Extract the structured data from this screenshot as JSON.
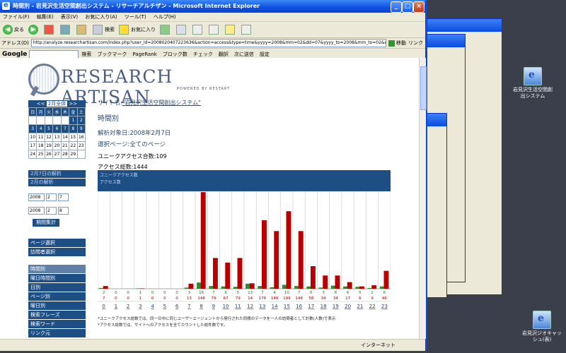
{
  "window": {
    "title": "時間別 - 岩見沢生活空間創出システム - リサーチアルチザン - Microsoft Internet Explorer"
  },
  "menu": [
    "ファイル(F)",
    "編集(E)",
    "表示(V)",
    "お気に入り(A)",
    "ツール(T)",
    "ヘルプ(H)"
  ],
  "toolbar": {
    "back": "戻る",
    "search": "検索",
    "favorites": "お気に入り"
  },
  "address": {
    "label": "アドレス(D)",
    "value": "http://analyze.researchartisan.com/index.php?user_id=2008020407223636&action=access&type=time&yyyy=2008&mm=02&dd=07&yyyy_to=2008&mm_to=02&dd",
    "go": "移動",
    "links": "リンク"
  },
  "google": {
    "logo": "Google",
    "items": [
      "検索",
      "ブックマーク",
      "PageRank",
      "ブロック数",
      "チェック",
      "翻訳",
      "次に送信"
    ],
    "settings": "設定"
  },
  "logo": {
    "name": "RESEARCH ARTISAN",
    "sub": "POWERED BY RESTART"
  },
  "calendar": {
    "prev": "<<",
    "month": "2月全体",
    "next": ">>",
    "days": [
      "日",
      "月",
      "火",
      "水",
      "木",
      "金",
      "土"
    ],
    "rows": [
      [
        "",
        "",
        "",
        "",
        "",
        "1",
        "2"
      ],
      [
        "3",
        "4",
        "5",
        "6",
        "7",
        "8",
        "9"
      ],
      [
        "10",
        "11",
        "12",
        "13",
        "14",
        "15",
        "16"
      ],
      [
        "17",
        "18",
        "19",
        "20",
        "21",
        "22",
        "23"
      ],
      [
        "24",
        "25",
        "26",
        "27",
        "28",
        "29",
        ""
      ]
    ]
  },
  "sidebar": {
    "analysis_day": "2月7日の解析",
    "analysis_month": "2月の解析",
    "from": {
      "year": "2008",
      "month": "2",
      "day": "7"
    },
    "to": {
      "year": "2008",
      "month": "2",
      "day": "8"
    },
    "calc_button": "期間集計",
    "page_select": "ページ選択",
    "visitor_select": "訪問者選択",
    "reports": [
      "時間別",
      "曜日時間別",
      "日別",
      "ページ別",
      "曜日別",
      "検索フレーズ",
      "検索ワード",
      "リンク元"
    ]
  },
  "main": {
    "site_prefix": "サイト名:",
    "site_name": "\"岩見沢生活空間創出システム\"",
    "heading": "時間別",
    "date": "解析対象日:2008年2月7日",
    "page": "選択ページ:全てのページ",
    "unique": "ユニークアクセス合数:109",
    "access": "アクセス総数:1444"
  },
  "chart_data": {
    "type": "bar",
    "legend": [
      "ユニークアクセス数",
      "アクセス数"
    ],
    "categories": [
      "0",
      "1",
      "2",
      "3",
      "4",
      "5",
      "6",
      "7",
      "8",
      "9",
      "10",
      "11",
      "12",
      "13",
      "14",
      "15",
      "16",
      "17",
      "18",
      "19",
      "20",
      "21",
      "22",
      "23"
    ],
    "series": [
      {
        "name": "ユニークアクセス数",
        "color": "#2e8b2e",
        "values": [
          2,
          0,
          0,
          1,
          0,
          0,
          0,
          3,
          16,
          7,
          6,
          5,
          13,
          7,
          4,
          10,
          7,
          6,
          3,
          8,
          6,
          5,
          2,
          6
        ]
      },
      {
        "name": "アクセス数",
        "color": "#b80000",
        "values": [
          7,
          0,
          0,
          1,
          0,
          0,
          0,
          13,
          248,
          79,
          67,
          79,
          14,
          176,
          148,
          199,
          148,
          58,
          34,
          34,
          17,
          6,
          9,
          46
        ]
      }
    ],
    "ylim": [
      0,
      250
    ]
  },
  "notes": [
    "*ユニークアクセス総数では、同一日中に同じユーザーエージェントから発行された同様のデータを一人の訪問者として計数(人数)で表示",
    "*アクセス総数では、サイトへのアクセスを全てカウントした総件数です。"
  ],
  "status": {
    "zone": "インターネット"
  },
  "desktop": {
    "icon1": "岩見沢生活空間創出システム",
    "icon2": "岩見沢ジオキャッシュ(表)"
  }
}
